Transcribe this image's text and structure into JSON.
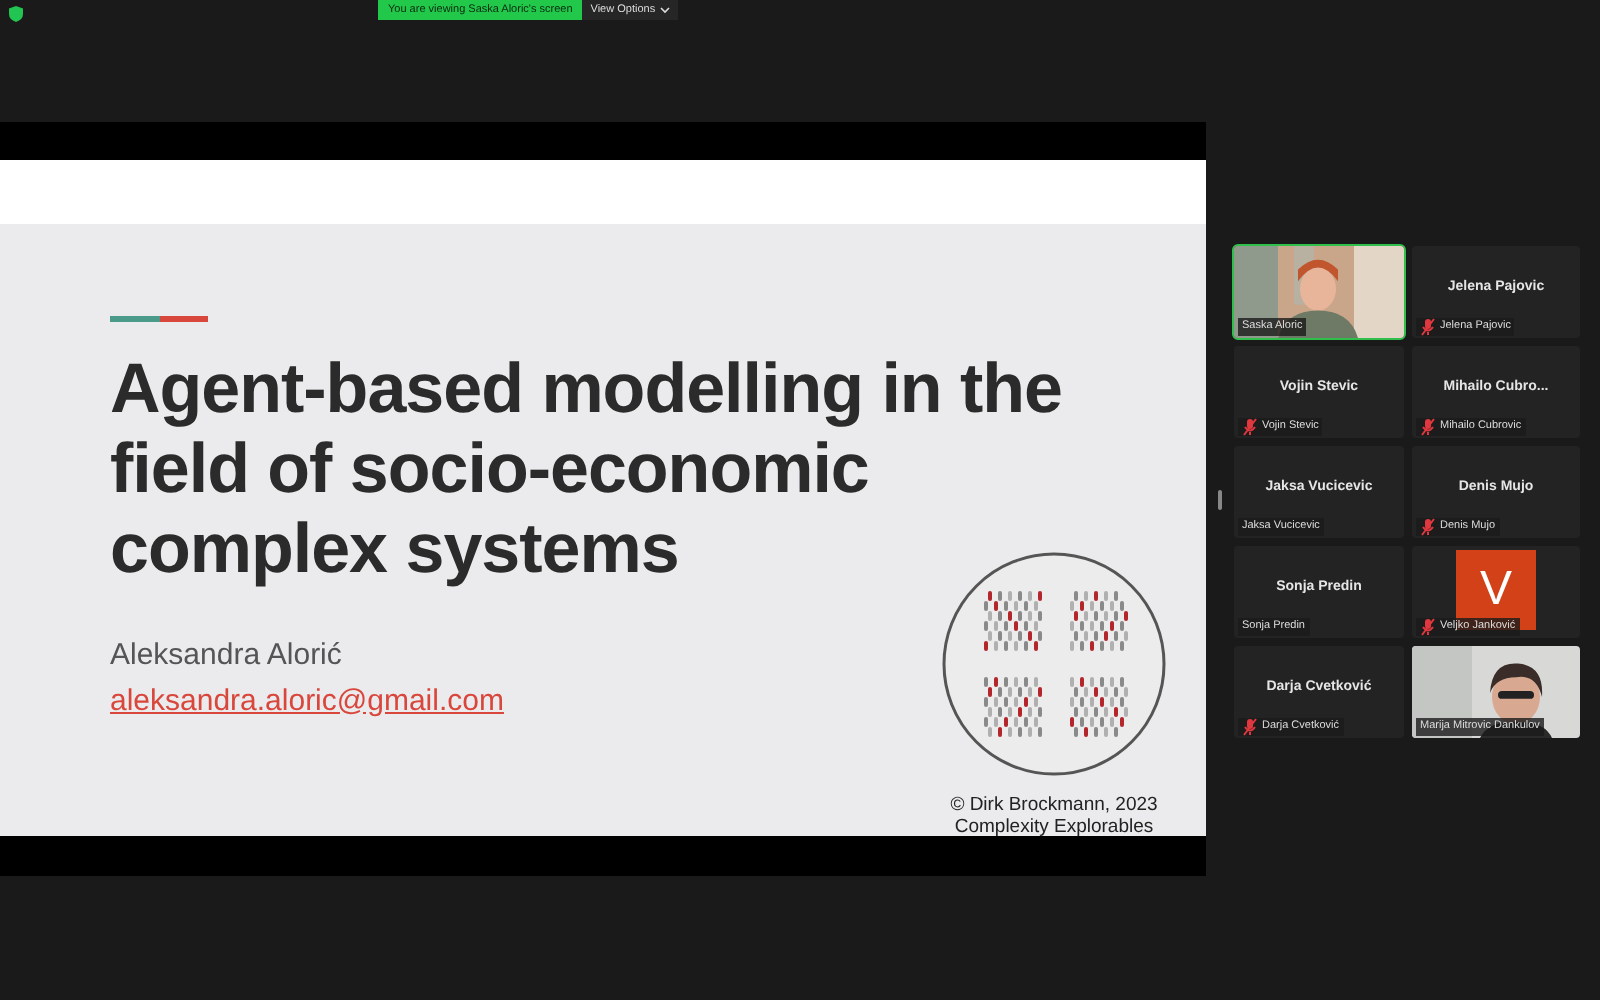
{
  "banner": {
    "text": "You are viewing Saska Aloric's screen",
    "options": "View Options"
  },
  "slide": {
    "title": "Agent-based modelling in the field of socio-economic complex systems",
    "author": "Aleksandra Alorić",
    "email": "aleksandra.aloric@gmail.com",
    "credit": [
      "© Dirk Brockmann, 2023",
      "Complexity Explorables"
    ]
  },
  "participants": [
    {
      "kind": "video",
      "label": "Saska Aloric",
      "muted": false,
      "speaking": true
    },
    {
      "kind": "name",
      "name": "Jelena Pajovic",
      "label": "Jelena Pajovic",
      "muted": true,
      "speaking": false
    },
    {
      "kind": "name",
      "name": "Vojin Stevic",
      "label": "Vojin Stevic",
      "muted": true,
      "speaking": false
    },
    {
      "kind": "name",
      "name": "Mihailo Cubro...",
      "label": "Mihailo Cubrovic",
      "muted": true,
      "speaking": false
    },
    {
      "kind": "name",
      "name": "Jaksa Vucicevic",
      "label": "Jaksa Vucicevic",
      "muted": false,
      "speaking": false
    },
    {
      "kind": "name",
      "name": "Denis Mujo",
      "label": "Denis Mujo",
      "muted": true,
      "speaking": false
    },
    {
      "kind": "name",
      "name": "Sonja Predin",
      "label": "Sonja Predin",
      "muted": false,
      "speaking": false
    },
    {
      "kind": "avatar",
      "initial": "V",
      "label": "Veljko Janković",
      "muted": true,
      "speaking": false
    },
    {
      "kind": "name",
      "name": "Darja Cvetković",
      "label": "Darja Cvetković",
      "muted": true,
      "speaking": false
    },
    {
      "kind": "video",
      "label": "Marija Mitrovic Dankulov",
      "muted": false,
      "speaking": false
    }
  ]
}
